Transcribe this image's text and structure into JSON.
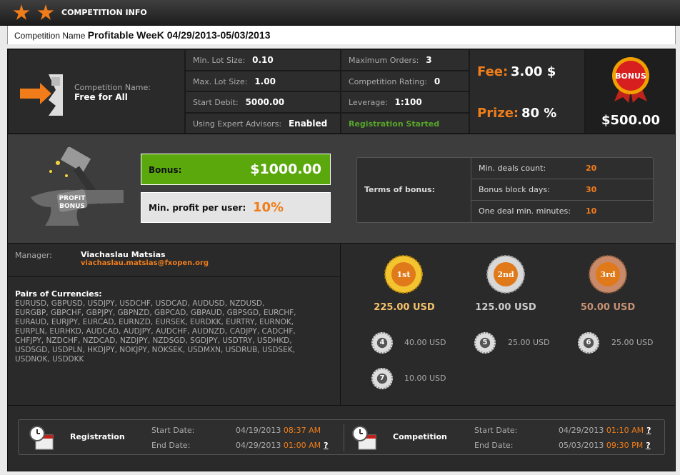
{
  "header": {
    "title": "COMPETITION INFO"
  },
  "competition": {
    "name_label": "Competition Name",
    "name_value": "Profitable WeeK 04/29/2013-05/03/2013"
  },
  "info": {
    "comp_name_label": "Competition Name:",
    "comp_name_value": "Free for All",
    "min_lot_label": "Min. Lot Size:",
    "min_lot": "0.10",
    "max_lot_label": "Max. Lot Size:",
    "max_lot": "1.00",
    "start_debit_label": "Start Debit:",
    "start_debit": "5000.00",
    "expert_label": "Using Expert Advisors:",
    "expert": "Enabled",
    "max_orders_label": "Maximum Orders:",
    "max_orders": "3",
    "rating_label": "Competition Rating:",
    "rating": "0",
    "leverage_label": "Leverage:",
    "leverage": "1:100",
    "registration_status": "Registration Started",
    "fee_label": "Fee:",
    "fee_value": "3.00 $",
    "prize_label": "Prize:",
    "prize_value": "80 %",
    "bonus_badge": "BONUS",
    "bonus_amount": "$500.00"
  },
  "bonus": {
    "icon_text_1": "PROFIT",
    "icon_text_2": "BONUS",
    "bonus_label": "Bonus:",
    "bonus_value": "$1000.00",
    "min_profit_label": "Min. profit per user:",
    "min_profit_value": "10%",
    "terms_label": "Terms of bonus:",
    "terms": [
      {
        "label": "Min. deals count:",
        "value": "20"
      },
      {
        "label": "Bonus block days:",
        "value": "30"
      },
      {
        "label": "One deal min. minutes:",
        "value": "10"
      }
    ]
  },
  "manager": {
    "label": "Manager:",
    "name": "Viachaslau Matsias",
    "email": "viachaslau.matsias@fxopen.org"
  },
  "pairs": {
    "title": "Pairs of Currencies:",
    "lines": [
      "EURUSD, GBPUSD, USDJPY, USDCHF, USDCAD, AUDUSD, NZDUSD,",
      "EURGBP, GBPCHF, GBPJPY, GBPNZD, GBPCAD, GBPAUD, GBPSGD, EURCHF,",
      "EURAUD, EURJPY, EURCAD, EURNZD, EURSEK, EURDKK, EURTRY, EURNOK,",
      "EURPLN, EURHKD, AUDCAD, AUDJPY, AUDCHF, AUDNZD, CADJPY, CADCHF,",
      "CHFJPY, NZDCHF, NZDCAD, NZDJPY, NZDSGD, SGDJPY, USDTRY, USDHKD,",
      "USDSGD, USDPLN, HKDJPY, NOKJPY, NOKSEK, USDMXN, USDRUB, USDSEK,",
      "USDNOK, USDDKK"
    ]
  },
  "prizes": {
    "first": {
      "badge": "1st",
      "amount": "225.00 USD"
    },
    "second": {
      "badge": "2nd",
      "amount": "125.00 USD"
    },
    "third": {
      "badge": "3rd",
      "amount": "50.00 USD"
    },
    "others": [
      {
        "place": "4",
        "amount": "40.00 USD"
      },
      {
        "place": "5",
        "amount": "25.00 USD"
      },
      {
        "place": "6",
        "amount": "25.00 USD"
      },
      {
        "place": "7",
        "amount": "10.00 USD"
      }
    ]
  },
  "schedule": {
    "registration": {
      "label": "Registration",
      "start_label": "Start Date:",
      "start_date": "04/19/2013",
      "start_time": "08:37 AM",
      "end_label": "End Date:",
      "end_date": "04/29/2013",
      "end_time": "01:00 AM",
      "help": "?"
    },
    "competition": {
      "label": "Competition",
      "start_label": "Start Date:",
      "start_date": "04/29/2013",
      "start_time": "01:10 AM",
      "end_label": "End Date:",
      "end_date": "05/03/2013",
      "end_time": "09:30 PM",
      "help_start": "?",
      "help_end": "?"
    }
  }
}
